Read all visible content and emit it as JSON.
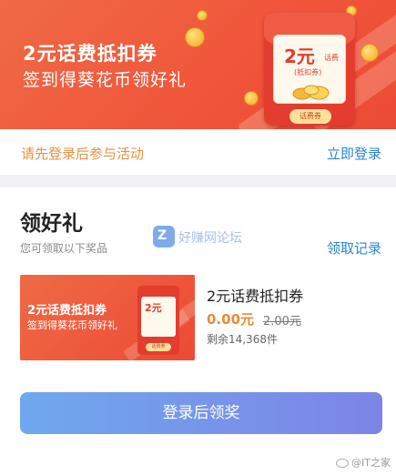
{
  "banner": {
    "title": "2元话费抵扣券",
    "subtitle": "签到得葵花币领好礼",
    "envelope": {
      "value": "2元",
      "unit": "话费",
      "note": "(抵扣券)",
      "tag": "话费券"
    }
  },
  "notice": {
    "text": "请先登录后参与活动",
    "login_link": "立即登录"
  },
  "rewards": {
    "title": "领好礼",
    "subtitle": "您可领取以下奖品",
    "records_link": "领取记录",
    "watermark": "好赚网论坛",
    "item": {
      "thumb_title": "2元话费抵扣券",
      "thumb_subtitle": "签到得葵花币领好礼",
      "thumb_value": "2元",
      "thumb_tag": "话费券",
      "name": "2元话费抵扣券",
      "price": "0.00元",
      "original_price": "2.00元",
      "stock": "剩余14,368件"
    },
    "cta_label": "登录后领奖"
  },
  "footer": {
    "watermark": "@IT之家"
  },
  "colors": {
    "banner_red": "#ec4a35",
    "link_blue": "#2b84d4",
    "notice_orange": "#e6913f",
    "price_orange": "#e98a3b",
    "cta_start": "#6fa8ee",
    "cta_end": "#7d84e6"
  }
}
